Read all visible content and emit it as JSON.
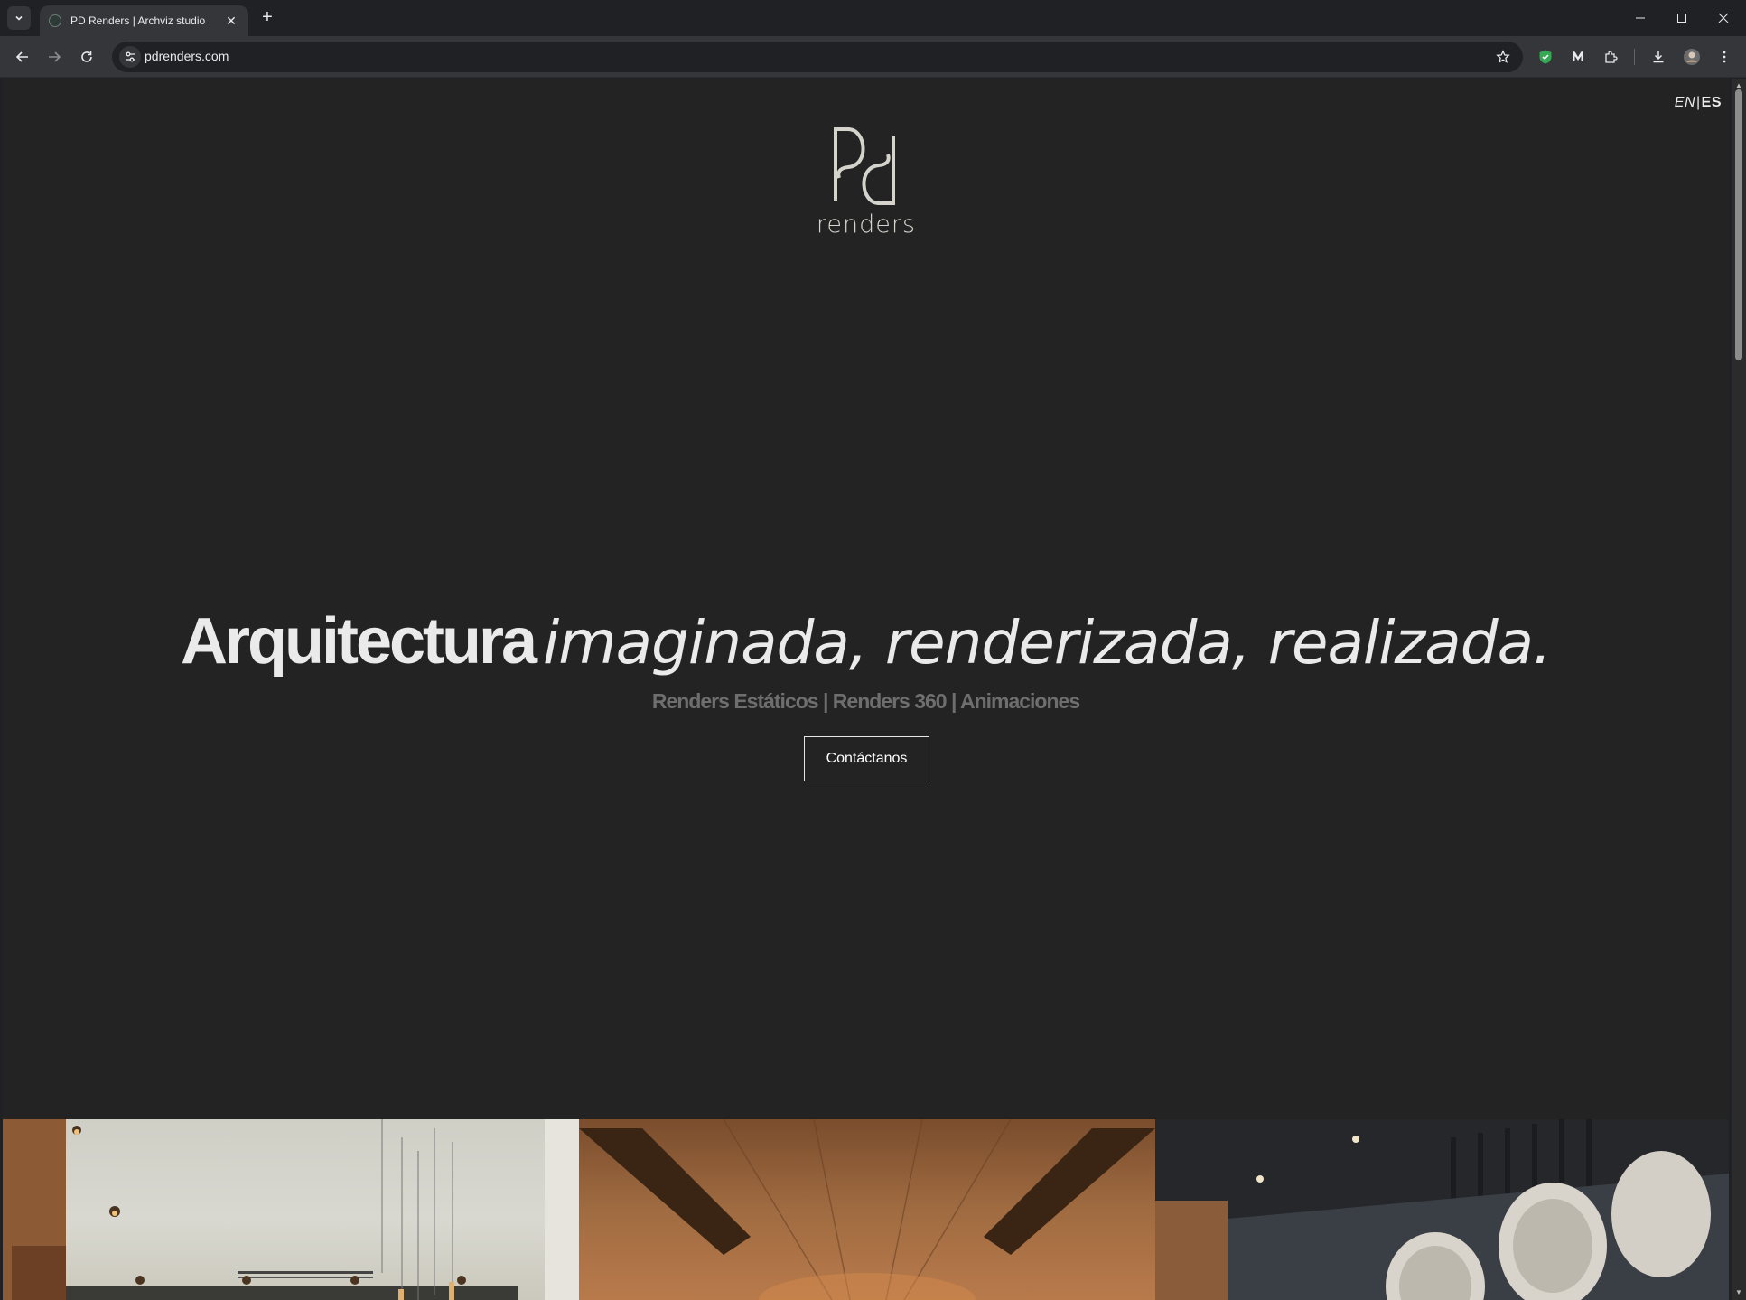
{
  "browser": {
    "tab_title": "PD Renders | Archviz studio",
    "url": "pdrenders.com"
  },
  "site": {
    "lang_en": "EN",
    "lang_sep": "|",
    "lang_es": "ES",
    "logo_text": "renders",
    "headline_bold": "Arquitectura",
    "headline_italic": "imaginada, renderizada, realizada.",
    "subline": "Renders Estáticos | Renders 360 | Animaciones",
    "cta_label": "Contáctanos"
  },
  "colors": {
    "page_bg": "#232323",
    "logo": "#d4d4cd",
    "subline": "#6e6e6e",
    "text": "#eaeaea"
  }
}
